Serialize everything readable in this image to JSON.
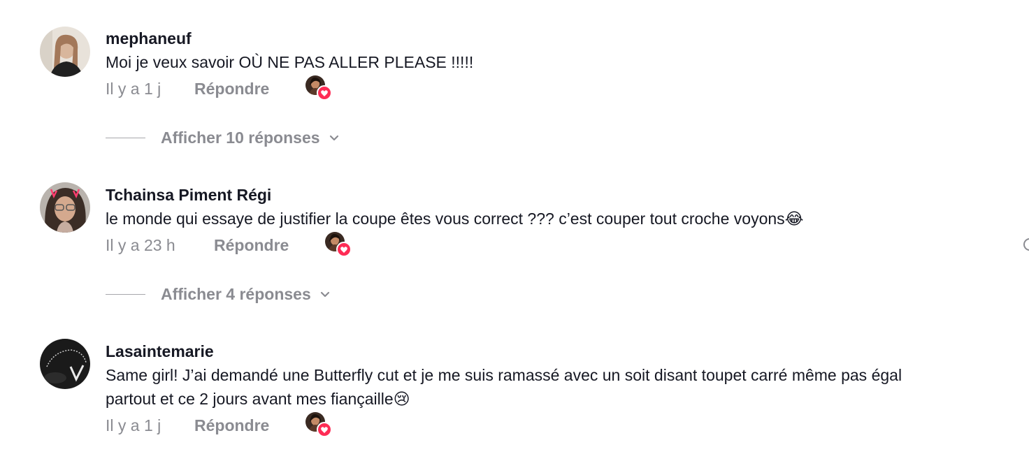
{
  "comments": [
    {
      "username": "mephaneuf",
      "text": "Moi je veux savoir OÙ NE PAS ALLER PLEASE !!!!!",
      "time": "Il y a 1 j",
      "reply_label": "Répondre",
      "view_replies": "Afficher 10 réponses"
    },
    {
      "username": "Tchainsa Piment Régi",
      "text": "le monde qui essaye de justifier la coupe êtes vous correct ??? c’est couper tout croche voyons😂",
      "time": "Il y a 23 h",
      "reply_label": "Répondre",
      "view_replies": "Afficher 4 réponses"
    },
    {
      "username": "Lasaintemarie",
      "text_line1": "Same girl! J’ai demandé une Butterfly cut et je me suis ramassé avec un soit disant toupet carré même pas égal",
      "text_line2": "partout et ce 2 jours avant mes fiançaille😢",
      "time": "Il y a 1 j",
      "reply_label": "Répondre"
    }
  ],
  "icons": {
    "liked_by_creator": "heart-icon",
    "expand": "chevron-down-icon"
  },
  "colors": {
    "heart": "#fe2c55",
    "muted_text": "#8a8b91"
  }
}
